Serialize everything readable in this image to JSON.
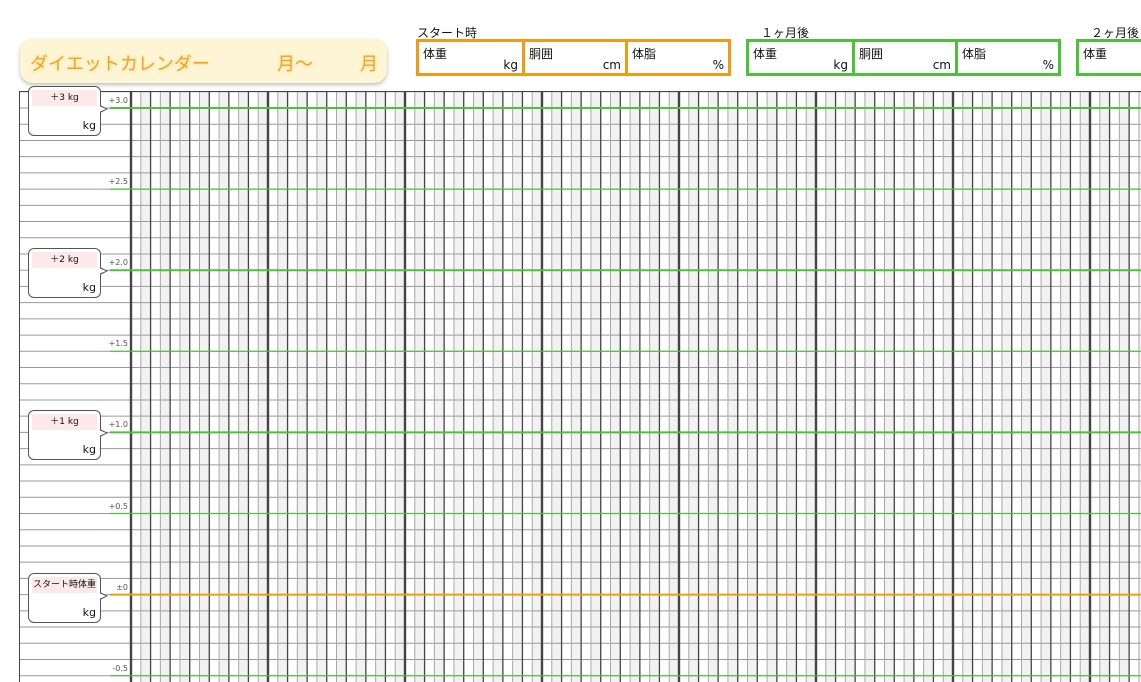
{
  "title": {
    "main": "ダイエットカレンダー",
    "from_month": "月〜",
    "to_month": "月"
  },
  "measurements": [
    {
      "label": "スタート時",
      "color": "#f29b12",
      "cells": [
        {
          "name": "体重",
          "unit": "kg"
        },
        {
          "name": "胴囲",
          "unit": "cm"
        },
        {
          "name": "体脂",
          "unit": "%"
        }
      ]
    },
    {
      "label": "１ヶ月後",
      "color": "#4cc23a",
      "cells": [
        {
          "name": "体重",
          "unit": "kg"
        },
        {
          "name": "胴囲",
          "unit": "cm"
        },
        {
          "name": "体脂",
          "unit": "%"
        }
      ]
    },
    {
      "label": "２ヶ月後",
      "color": "#4cc23a",
      "cells": [
        {
          "name": "体重",
          "unit": ""
        }
      ]
    }
  ],
  "chart": {
    "y_ticks": [
      "+3.0",
      "+2.5",
      "+2.0",
      "+1.5",
      "+1.0",
      "+0.5",
      "±0",
      "-0.5"
    ],
    "y_values": [
      3.0,
      2.5,
      2.0,
      1.5,
      1.0,
      0.5,
      0.0,
      -0.5
    ],
    "baseline_color": "#f29b12",
    "target_color": "#4cc23a",
    "callouts": [
      {
        "label": "＋3 kg",
        "unit": "kg",
        "value": 3.0
      },
      {
        "label": "＋2 kg",
        "unit": "kg",
        "value": 2.0
      },
      {
        "label": "＋1 kg",
        "unit": "kg",
        "value": 1.0
      },
      {
        "label": "スタート時体重",
        "unit": "kg",
        "value": 0.0
      }
    ],
    "rows_per_half_kg": 5,
    "days_visible": 73
  }
}
